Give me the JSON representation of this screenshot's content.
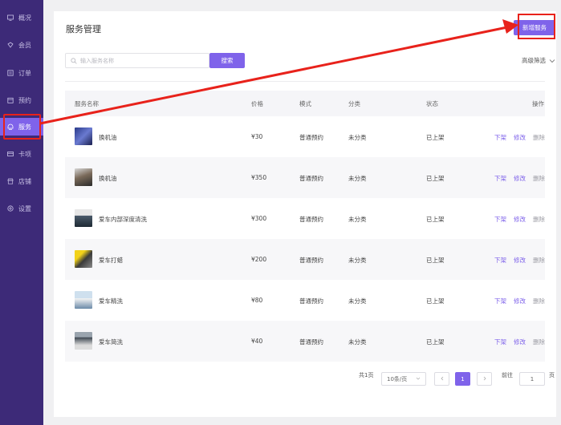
{
  "sidebar": {
    "items": [
      {
        "label": "概况",
        "icon": "monitor-icon"
      },
      {
        "label": "会员",
        "icon": "member-icon"
      },
      {
        "label": "订单",
        "icon": "order-icon"
      },
      {
        "label": "预约",
        "icon": "calendar-icon"
      },
      {
        "label": "服务",
        "icon": "service-icon",
        "active": true
      },
      {
        "label": "卡项",
        "icon": "card-icon"
      },
      {
        "label": "店铺",
        "icon": "shop-icon"
      },
      {
        "label": "设置",
        "icon": "settings-icon"
      }
    ]
  },
  "header": {
    "title": "服务管理",
    "add_button": "新增服务"
  },
  "search": {
    "placeholder": "输入服务名称",
    "button": "搜索",
    "advanced": "高级筛选"
  },
  "table": {
    "columns": [
      "服务名称",
      "价格",
      "模式",
      "分类",
      "状态",
      "操作"
    ],
    "rows": [
      {
        "name": "换机油",
        "price": "¥30",
        "mode": "普通预约",
        "category": "未分类",
        "status": "已上架"
      },
      {
        "name": "换机油",
        "price": "¥350",
        "mode": "普通预约",
        "category": "未分类",
        "status": "已上架"
      },
      {
        "name": "爱车内部深度清洗",
        "price": "¥300",
        "mode": "普通预约",
        "category": "未分类",
        "status": "已上架"
      },
      {
        "name": "爱车打蜡",
        "price": "¥200",
        "mode": "普通预约",
        "category": "未分类",
        "status": "已上架"
      },
      {
        "name": "爱车精洗",
        "price": "¥80",
        "mode": "普通预约",
        "category": "未分类",
        "status": "已上架"
      },
      {
        "name": "爱车简洗",
        "price": "¥40",
        "mode": "普通预约",
        "category": "未分类",
        "status": "已上架"
      }
    ],
    "actions": {
      "offshelf": "下架",
      "edit": "修改",
      "delete": "删除"
    }
  },
  "pagination": {
    "total": "共1页",
    "page_size": "10条/页",
    "current_page": "1",
    "goto_label": "前往",
    "goto_value": "1",
    "page_suffix": "页"
  },
  "colors": {
    "accent": "#7f63ea",
    "sidebar": "#3d2a78",
    "highlight": "#e8221b"
  }
}
